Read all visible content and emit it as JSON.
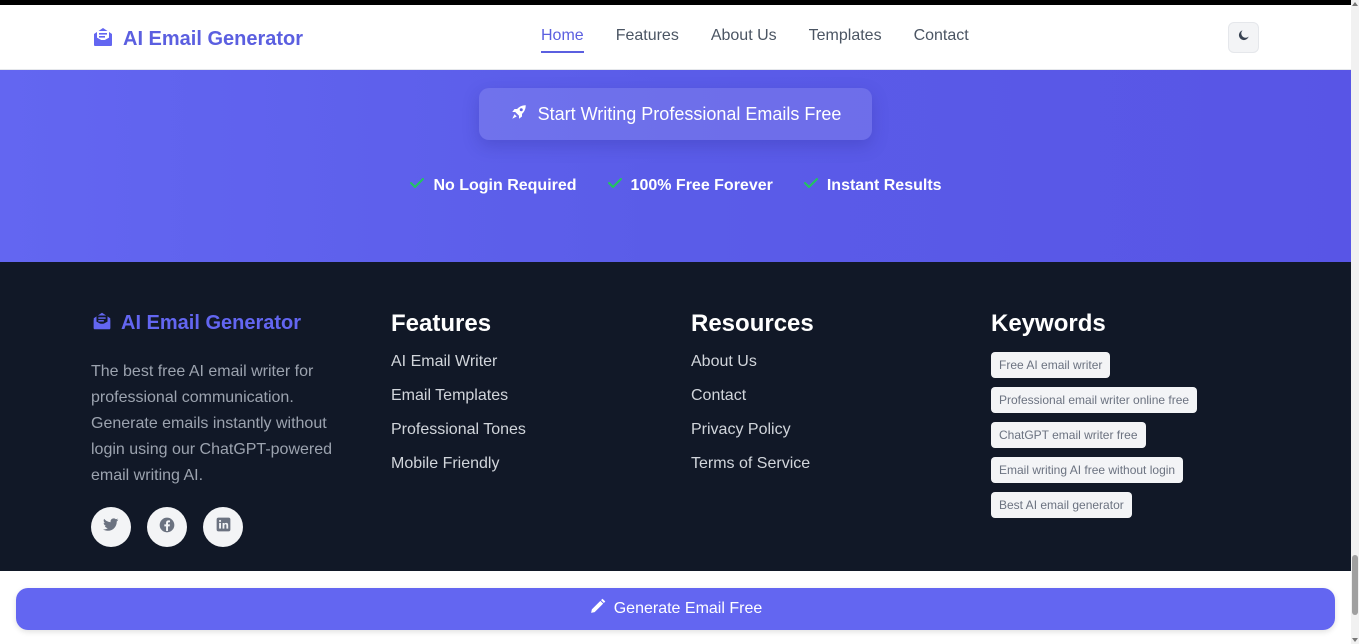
{
  "header": {
    "brand": "AI Email Generator",
    "nav": [
      {
        "label": "Home",
        "active": true
      },
      {
        "label": "Features",
        "active": false
      },
      {
        "label": "About Us",
        "active": false
      },
      {
        "label": "Templates",
        "active": false
      },
      {
        "label": "Contact",
        "active": false
      }
    ],
    "theme_toggle_icon": "moon-icon"
  },
  "hero": {
    "cta_label": "Start Writing Professional Emails Free",
    "cta_icon": "rocket-icon",
    "checks": [
      "No Login Required",
      "100% Free Forever",
      "Instant Results"
    ]
  },
  "footer": {
    "brand": "AI Email Generator",
    "description": "The best free AI email writer for professional communication. Generate emails instantly without login using our ChatGPT-powered email writing AI.",
    "socials": [
      "twitter-icon",
      "facebook-icon",
      "linkedin-icon"
    ],
    "features": {
      "title": "Features",
      "links": [
        "AI Email Writer",
        "Email Templates",
        "Professional Tones",
        "Mobile Friendly"
      ]
    },
    "resources": {
      "title": "Resources",
      "links": [
        "About Us",
        "Contact",
        "Privacy Policy",
        "Terms of Service"
      ]
    },
    "keywords": {
      "title": "Keywords",
      "tags": [
        "Free AI email writer",
        "Professional email writer online free",
        "ChatGPT email writer free",
        "Email writing AI free without login",
        "Best AI email generator"
      ]
    }
  },
  "bottom_button": {
    "label": "Generate Email Free",
    "icon": "pencil-icon"
  },
  "colors": {
    "accent": "#6366f1",
    "footer_bg": "#111827",
    "check": "#22c55e"
  }
}
